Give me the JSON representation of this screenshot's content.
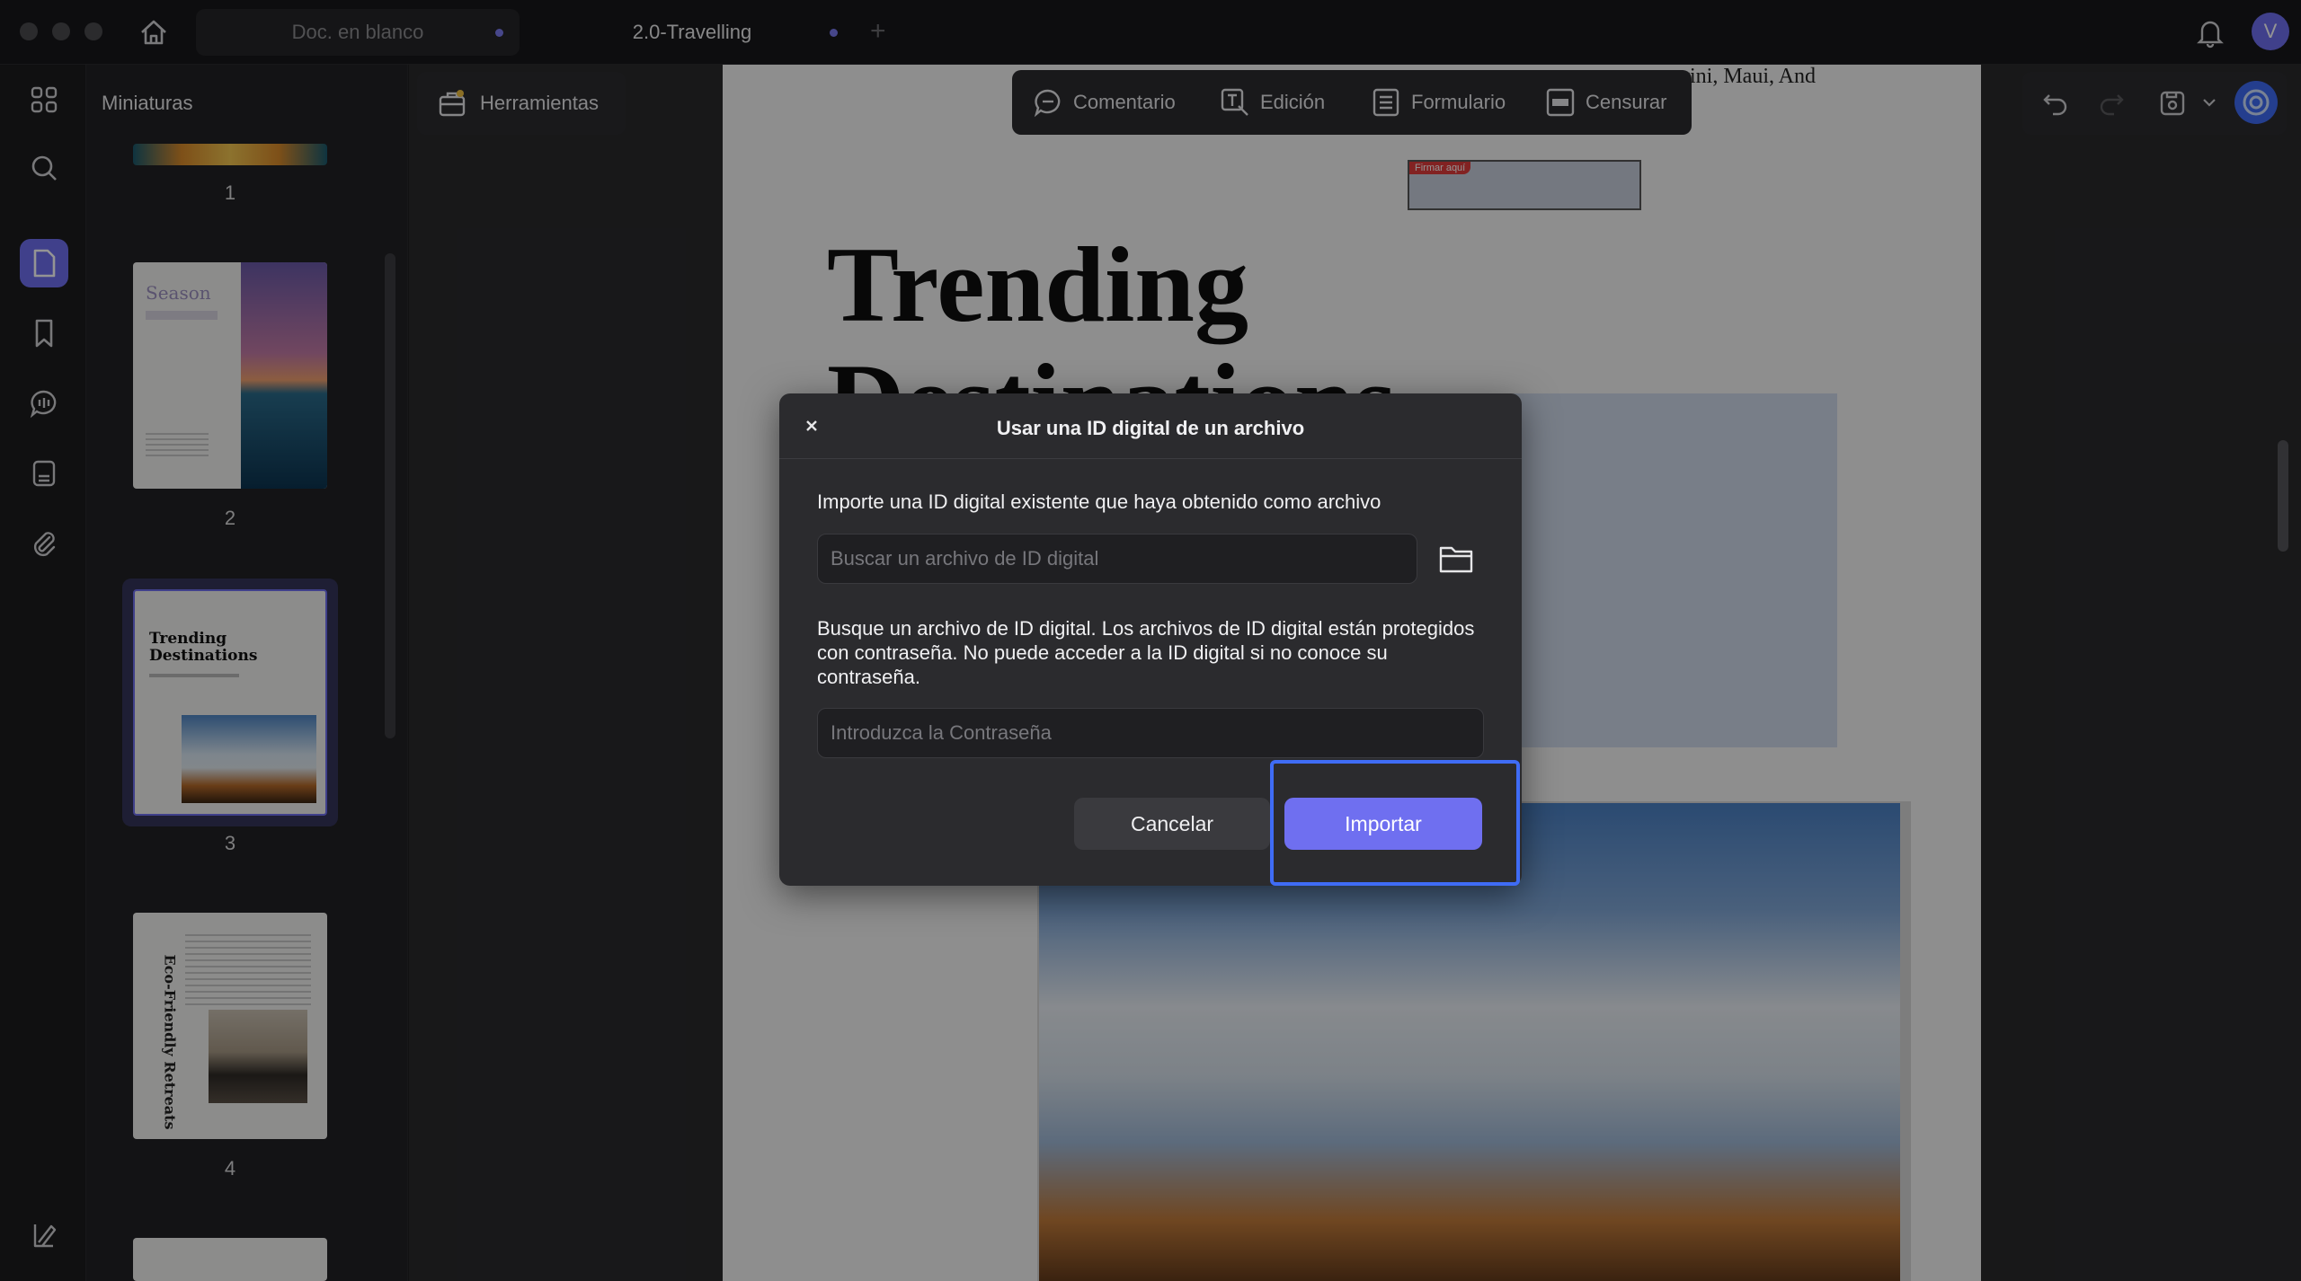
{
  "tabs": [
    {
      "label": "Doc. en blanco"
    },
    {
      "label": "2.0-Travelling"
    }
  ],
  "user": {
    "avatar_initial": "V"
  },
  "sidebar": {
    "title": "Miniaturas"
  },
  "thumbnails": [
    {
      "num": "1"
    },
    {
      "num": "2",
      "title": "Season"
    },
    {
      "num": "3",
      "title": "Trending Destinations"
    },
    {
      "num": "4",
      "title": "Eco-Friendly Retreats"
    }
  ],
  "toolbar": {
    "tools_label": "Herramientas",
    "comment_label": "Comentario",
    "edit_label": "Edición",
    "form_label": "Formulario",
    "censor_label": "Censurar"
  },
  "document": {
    "top_text": "rini, Maui, And",
    "sign_here": "Firmar aquí",
    "heading_line1": "Trending",
    "heading_line2": "Destinations"
  },
  "dialog": {
    "title": "Usar una ID digital de un archivo",
    "intro": "Importe una ID digital existente que haya obtenido como archivo",
    "file_placeholder": "Buscar un archivo de ID digital",
    "description": "Busque un archivo de ID digital. Los archivos de ID digital están protegidos con contraseña. No puede acceder a la ID digital si no conoce su contraseña.",
    "password_placeholder": "Introduzca la Contraseña",
    "cancel_label": "Cancelar",
    "import_label": "Importar"
  },
  "colors": {
    "accent": "#6f6ff0",
    "highlight": "#3f6cf5"
  }
}
